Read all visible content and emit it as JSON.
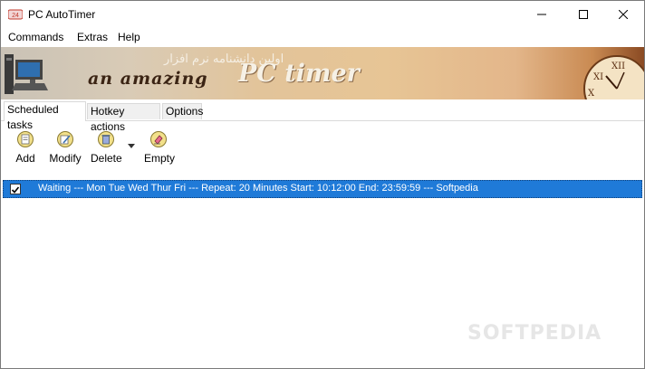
{
  "window": {
    "title": "PC AutoTimer",
    "icon": "pc-autotimer-app-icon"
  },
  "caption_buttons": [
    "minimize-icon",
    "maximize-icon",
    "close-icon"
  ],
  "menu": {
    "items": [
      "Commands",
      "Extras",
      "Help"
    ]
  },
  "banner": {
    "persian_text": "اولین دانشنامه نرم افزار",
    "tagline": "an amazing",
    "logo": "PC timer"
  },
  "tabs": [
    {
      "label": "Scheduled tasks",
      "active": true
    },
    {
      "label": "Hotkey actions",
      "active": false
    },
    {
      "label": "Options",
      "active": false
    }
  ],
  "toolbar": {
    "buttons": [
      {
        "label": "Add",
        "icon": "add-task-icon"
      },
      {
        "label": "Modify",
        "icon": "modify-task-icon"
      },
      {
        "label": "Delete",
        "icon": "delete-task-icon"
      },
      {
        "label": "Empty",
        "icon": "empty-list-icon"
      }
    ]
  },
  "tasks": [
    {
      "checked": true,
      "text": "Waiting --- Mon Tue Wed Thur Fri --- Repeat: 20 Minutes  Start: 10:12:00   End: 23:59:59 --- Softpedia"
    }
  ],
  "watermark": "SOFTPEDIA",
  "colors": {
    "selection": "#1f7ad8",
    "banner_warm": "#e7c595"
  }
}
